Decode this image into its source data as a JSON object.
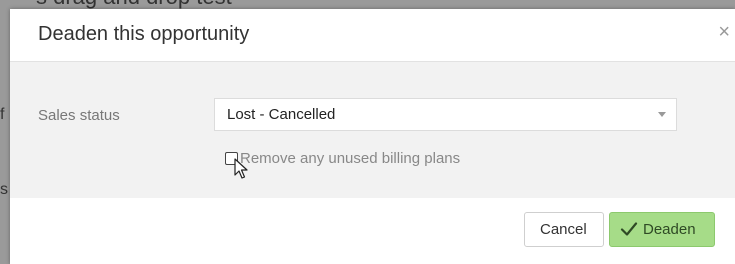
{
  "background": {
    "heading_fragment": "s drag and drop test",
    "left_chars": [
      "f",
      "s"
    ]
  },
  "modal": {
    "title": "Deaden this opportunity",
    "close_symbol": "×",
    "fields": {
      "sales_status": {
        "label": "Sales status",
        "value": "Lost - Cancelled"
      },
      "remove_billing_plans": {
        "label": "Remove any unused billing plans",
        "checked": false
      }
    },
    "buttons": {
      "cancel_label": "Cancel",
      "deaden_label": "Deaden"
    }
  },
  "colors": {
    "primary_green": "#a6dc88",
    "primary_green_border": "#8cc96d",
    "body_bg": "#f2f2f2",
    "overlay": "#9a9a9a"
  },
  "icons": {
    "close": "close-icon",
    "caret": "chevron-down-icon",
    "check": "check-icon",
    "cursor": "mouse-pointer-icon"
  }
}
